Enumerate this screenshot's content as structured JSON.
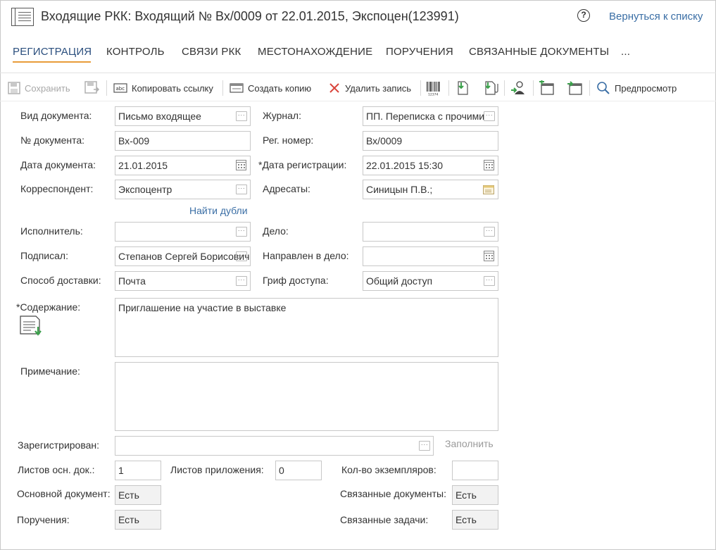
{
  "header": {
    "title": "Входящие РКК: Входящий № Вх/0009 от 22.01.2015, Экспоцен(123991)",
    "help": "?",
    "back_link": "Вернуться к списку"
  },
  "tabs": [
    {
      "label": "РЕГИСТРАЦИЯ"
    },
    {
      "label": "КОНТРОЛЬ"
    },
    {
      "label": "СВЯЗИ РКК"
    },
    {
      "label": "МЕСТОНАХОЖДЕНИЕ"
    },
    {
      "label": "ПОРУЧЕНИЯ"
    },
    {
      "label": "СВЯЗАННЫЕ ДОКУМЕНТЫ"
    },
    {
      "label": "..."
    }
  ],
  "toolbar": {
    "save": "Сохранить",
    "copy_link": "Копировать ссылку",
    "create_copy": "Создать копию",
    "delete": "Удалить запись",
    "preview": "Предпросмотр",
    "barcode_caption": "12374"
  },
  "form": {
    "doc_type": {
      "label": "Вид документа:",
      "value": "Письмо входящее"
    },
    "journal": {
      "label": "Журнал:",
      "value": "ПП. Переписка с прочими"
    },
    "doc_number": {
      "label": "№ документа:",
      "value": "Вх-009"
    },
    "reg_number": {
      "label": "Рег. номер:",
      "value": "Вх/0009"
    },
    "doc_date": {
      "label": "Дата документа:",
      "value": "21.01.2015"
    },
    "reg_date": {
      "label": "*Дата регистрации:",
      "value": "22.01.2015 15:30"
    },
    "correspondent": {
      "label": "Корреспондент:",
      "value": "Экспоцентр"
    },
    "addressees": {
      "label": "Адресаты:",
      "value": "Синицын П.В.;"
    },
    "find_duplicates": "Найти дубли",
    "executor": {
      "label": "Исполнитель:",
      "value": ""
    },
    "case": {
      "label": "Дело:",
      "value": ""
    },
    "signed": {
      "label": "Подписал:",
      "value": "Степанов Сергей Борисович"
    },
    "sent_to_case": {
      "label": "Направлен в дело:",
      "value": ""
    },
    "delivery": {
      "label": "Способ доставки:",
      "value": "Почта"
    },
    "access": {
      "label": "Гриф доступа:",
      "value": "Общий доступ"
    },
    "content": {
      "label": "*Содержание:",
      "value": "Приглашение на участие в выставке"
    },
    "note": {
      "label": "Примечание:",
      "value": ""
    },
    "registered": {
      "label": "Зарегистрирован:",
      "value": ""
    },
    "fill": "Заполнить",
    "main_sheets": {
      "label": "Листов осн. док.:",
      "value": "1"
    },
    "appendix_sheets": {
      "label": "Листов приложения:",
      "value": "0"
    },
    "copies": {
      "label": "Кол-во экземпляров:",
      "value": ""
    },
    "main_doc": {
      "label": "Основной документ:",
      "value": "Есть"
    },
    "related_docs": {
      "label": "Связанные документы:",
      "value": "Есть"
    },
    "orders": {
      "label": "Поручения:",
      "value": "Есть"
    },
    "related_tasks": {
      "label": "Связанные задачи:",
      "value": "Есть"
    }
  },
  "colors": {
    "accent": "#e89c3a",
    "link": "#3a6ea5",
    "icon_green": "#3aa04a"
  }
}
